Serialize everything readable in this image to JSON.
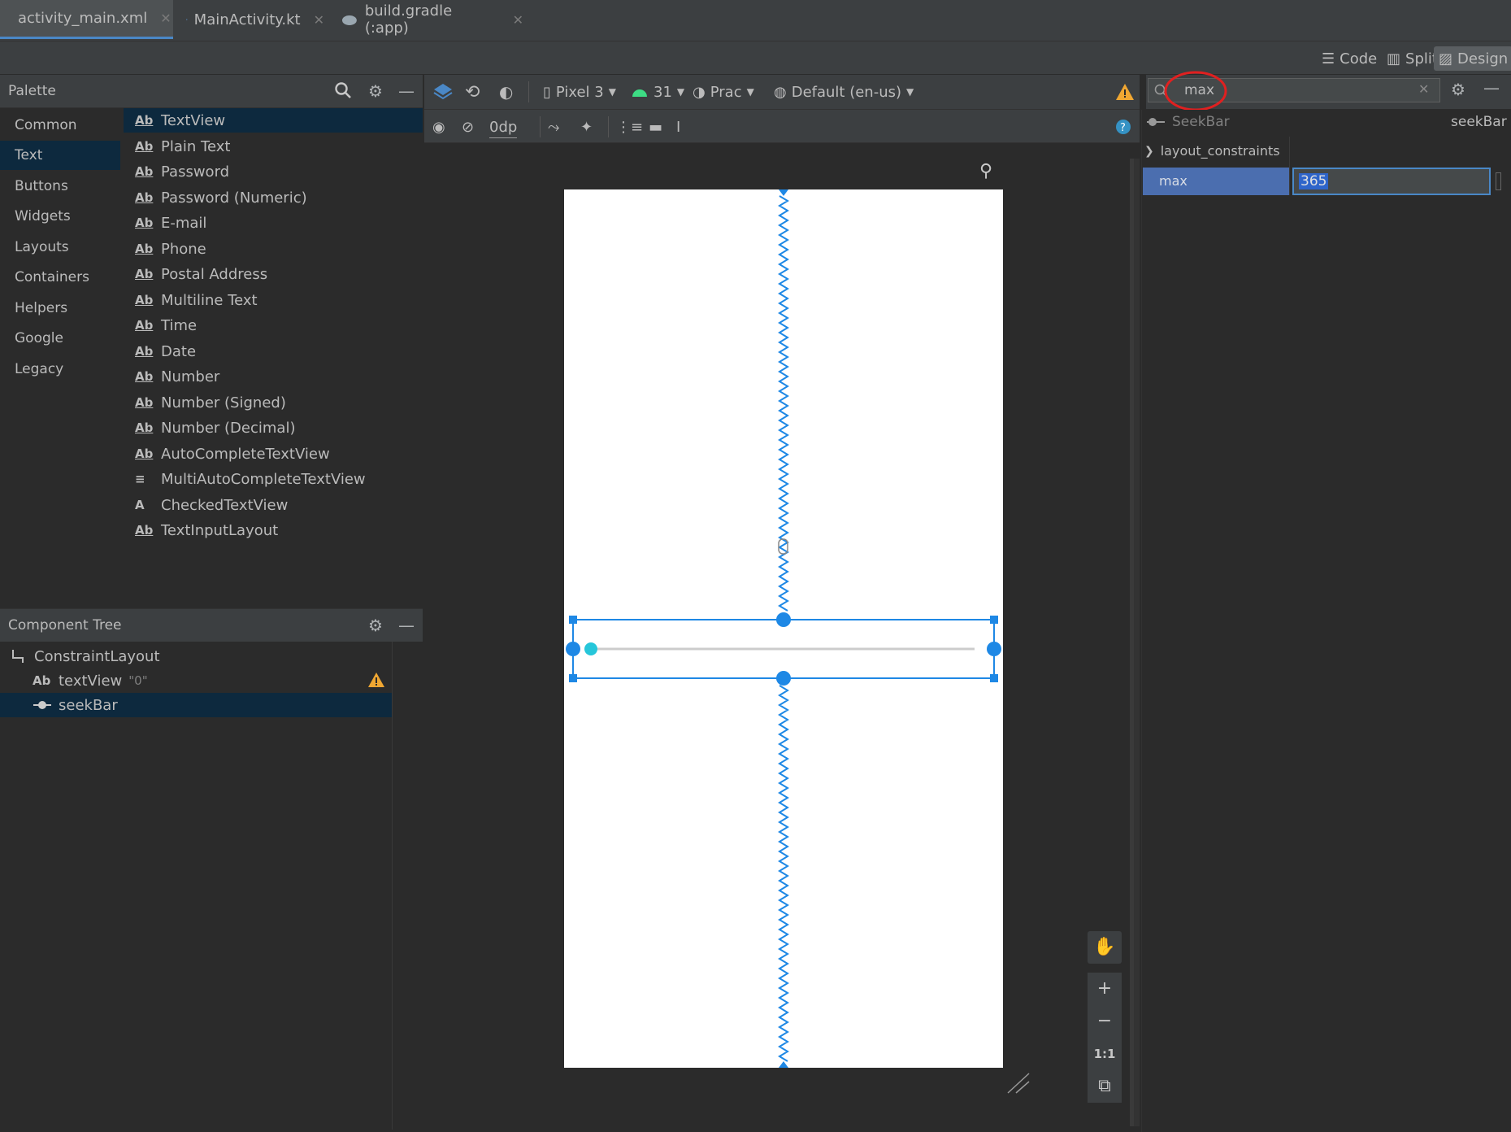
{
  "tabs": [
    {
      "label": "activity_main.xml",
      "icon": "xml-layout-icon"
    },
    {
      "label": "MainActivity.kt",
      "icon": "kotlin-file-icon"
    },
    {
      "label": "build.gradle (:app)",
      "icon": "gradle-icon"
    }
  ],
  "modes": {
    "code": "Code",
    "split": "Split",
    "design": "Design"
  },
  "palette": {
    "title": "Palette",
    "categories": [
      "Common",
      "Text",
      "Buttons",
      "Widgets",
      "Layouts",
      "Containers",
      "Helpers",
      "Google",
      "Legacy"
    ],
    "active_category": "Text",
    "items": [
      {
        "label": "TextView",
        "icon": "Ab"
      },
      {
        "label": "Plain Text",
        "icon": "Ab"
      },
      {
        "label": "Password",
        "icon": "Ab"
      },
      {
        "label": "Password (Numeric)",
        "icon": "Ab"
      },
      {
        "label": "E-mail",
        "icon": "Ab"
      },
      {
        "label": "Phone",
        "icon": "Ab"
      },
      {
        "label": "Postal Address",
        "icon": "Ab"
      },
      {
        "label": "Multiline Text",
        "icon": "Ab"
      },
      {
        "label": "Time",
        "icon": "Ab"
      },
      {
        "label": "Date",
        "icon": "Ab"
      },
      {
        "label": "Number",
        "icon": "Ab"
      },
      {
        "label": "Number (Signed)",
        "icon": "Ab"
      },
      {
        "label": "Number (Decimal)",
        "icon": "Ab"
      },
      {
        "label": "AutoCompleteTextView",
        "icon": "Ab"
      },
      {
        "label": "MultiAutoCompleteTextView",
        "icon": "≡"
      },
      {
        "label": "CheckedTextView",
        "icon": "A"
      },
      {
        "label": "TextInputLayout",
        "icon": "Ab"
      }
    ]
  },
  "tree": {
    "title": "Component Tree",
    "root": "ConstraintLayout",
    "children": [
      {
        "label": "textView",
        "hint": "\"0\"",
        "icon": "Ab"
      },
      {
        "label": "seekBar",
        "hint": ""
      }
    ]
  },
  "design_toolbar": {
    "device": "Pixel 3",
    "api": "31",
    "theme": "Prac",
    "locale": "Default (en-us)",
    "margin": "0dp"
  },
  "attributes": {
    "search_value": "max",
    "component_type": "SeekBar",
    "component_id": "seekBar",
    "group": "layout_constraints",
    "attr_name": "max",
    "attr_value": "365"
  },
  "zoom": {
    "fit": "1:1"
  },
  "colors": {
    "accent": "#4a88c7",
    "selection": "#0d293e",
    "constraint": "#1e88e5",
    "thumb": "#26c6da",
    "warning": "#f0a732",
    "annotation": "#e02020"
  }
}
